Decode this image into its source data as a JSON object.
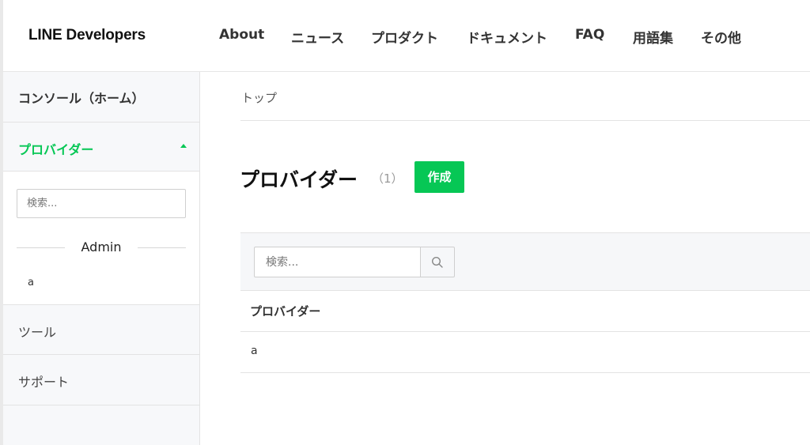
{
  "header": {
    "logo": "LINE Developers",
    "nav": [
      {
        "label": "About"
      },
      {
        "label": "ニュース"
      },
      {
        "label": "プロダクト"
      },
      {
        "label": "ドキュメント"
      },
      {
        "label": "FAQ"
      },
      {
        "label": "用語集"
      },
      {
        "label": "その他"
      }
    ]
  },
  "sidebar": {
    "console": "コンソール（ホーム）",
    "provider": "プロバイダー",
    "search_placeholder": "検索...",
    "group_label": "Admin",
    "provider_items": [
      "a"
    ],
    "tools": "ツール",
    "support": "サポート"
  },
  "main": {
    "breadcrumb": "トップ",
    "title": "プロバイダー",
    "count": "（1）",
    "create_label": "作成",
    "search_placeholder": "検索...",
    "table": {
      "header": "プロバイダー",
      "rows": [
        "a"
      ]
    }
  },
  "colors": {
    "accent": "#06c755",
    "sidebar_bg": "#f7f8fa",
    "border": "#e3e3e3"
  }
}
